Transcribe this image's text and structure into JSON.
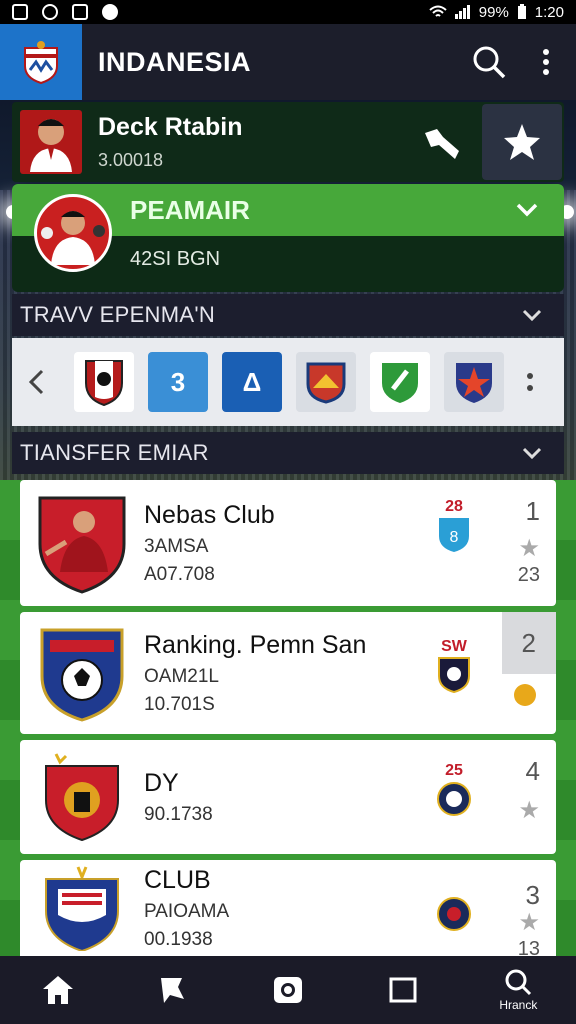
{
  "status_bar": {
    "battery": "99%",
    "time": "1:20"
  },
  "app_bar": {
    "title": "INDANESIA"
  },
  "player": {
    "name": "Deck Rtabin",
    "sub": "3.00018"
  },
  "premium": {
    "title": "PEAMAIR",
    "sub": "42SI BGN"
  },
  "section_transfer_top": {
    "label": "TRAVV EPENMA'N"
  },
  "club_strip": {
    "items": [
      {
        "label": "",
        "color": "#ffffff"
      },
      {
        "label": "3",
        "color": "#3a8fd6"
      },
      {
        "label": "Δ",
        "color": "#1a5fb4"
      },
      {
        "label": "",
        "color": "#d9dde3"
      },
      {
        "label": "",
        "color": "#ffffff"
      },
      {
        "label": "",
        "color": "#d9dde3"
      }
    ]
  },
  "section_transfer": {
    "label": "TIANSFER EMIAR"
  },
  "list": [
    {
      "title": "Nebas Club",
      "line1": "3AMSA",
      "line2": "A07.708",
      "badge_top": "28",
      "rank": "1",
      "rank_sub": "23"
    },
    {
      "title": "Ranking. Pemn San",
      "line1": "OAM21L",
      "line2": "10.701S",
      "badge_top": "SW",
      "rank": "2",
      "rank_sub": ""
    },
    {
      "title": "DY",
      "line1": "",
      "line2": "90.1738",
      "badge_top": "25",
      "rank": "4",
      "rank_sub": ""
    },
    {
      "title": "CLUB",
      "line1": "PAIOAMA",
      "line2": "00.1938",
      "badge_top": "",
      "rank": "3",
      "rank_sub": "13"
    }
  ],
  "bottom_nav": {
    "last_label": "Hranck"
  },
  "colors": {
    "accent_green": "#47a83a",
    "app_blue": "#1d73c9",
    "dark": "#1c1e2b"
  }
}
